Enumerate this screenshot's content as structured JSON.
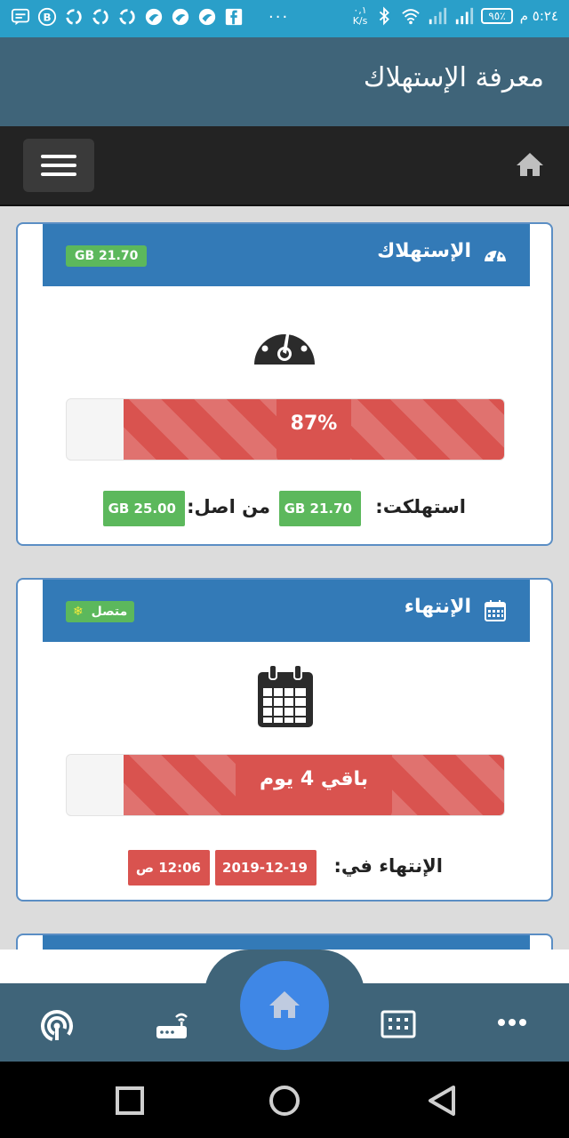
{
  "status_bar": {
    "time": "٥:٢٤ م",
    "battery": "٩٥٪",
    "speed_value": "٠,١",
    "speed_unit": "K/s",
    "overflow": "···",
    "icons": [
      "message-icon",
      "b-icon",
      "recycle-icon",
      "recycle-icon",
      "recycle-icon",
      "bird-icon",
      "bird-icon",
      "bird-icon",
      "facebook-icon",
      "bluetooth-icon",
      "wifi-icon",
      "signal-icon",
      "signal-icon"
    ]
  },
  "app": {
    "title": "معرفة الإستهلاك"
  },
  "nav": {
    "menu_icon": "hamburger-icon",
    "home_icon": "home-icon"
  },
  "consumption_card": {
    "title": "الإستهلاك",
    "icon": "dashboard-icon",
    "badge": "21.70 GB",
    "progress_percent": 87,
    "progress_label": "87%",
    "consumed_label": "استهلكت:",
    "consumed_value": "21.70 GB",
    "of_total_label": "من اصل:",
    "total_value": "25.00 GB"
  },
  "expiry_card": {
    "title": "الإنتهاء",
    "icon": "calendar-icon",
    "badge": "متصل",
    "badge_icon": "snowflake-icon",
    "progress_percent": 87,
    "progress_label": "باقي 4 يوم",
    "expiry_label": "الإنتهاء في:",
    "expiry_date": "2019-12-19",
    "expiry_time": "12:06 ص"
  },
  "bottom_nav": {
    "items": [
      "broadcast-icon",
      "router-icon",
      "home-icon",
      "dialpad-icon",
      "more-icon"
    ]
  },
  "colors": {
    "status_bar": "#2a9fc9",
    "app_bar": "#3f6479",
    "nav_bar": "#232323",
    "card_header": "#337ab7",
    "progress_red": "#d9534f",
    "badge_green": "#5cb85c",
    "fab": "#3f87e6"
  }
}
